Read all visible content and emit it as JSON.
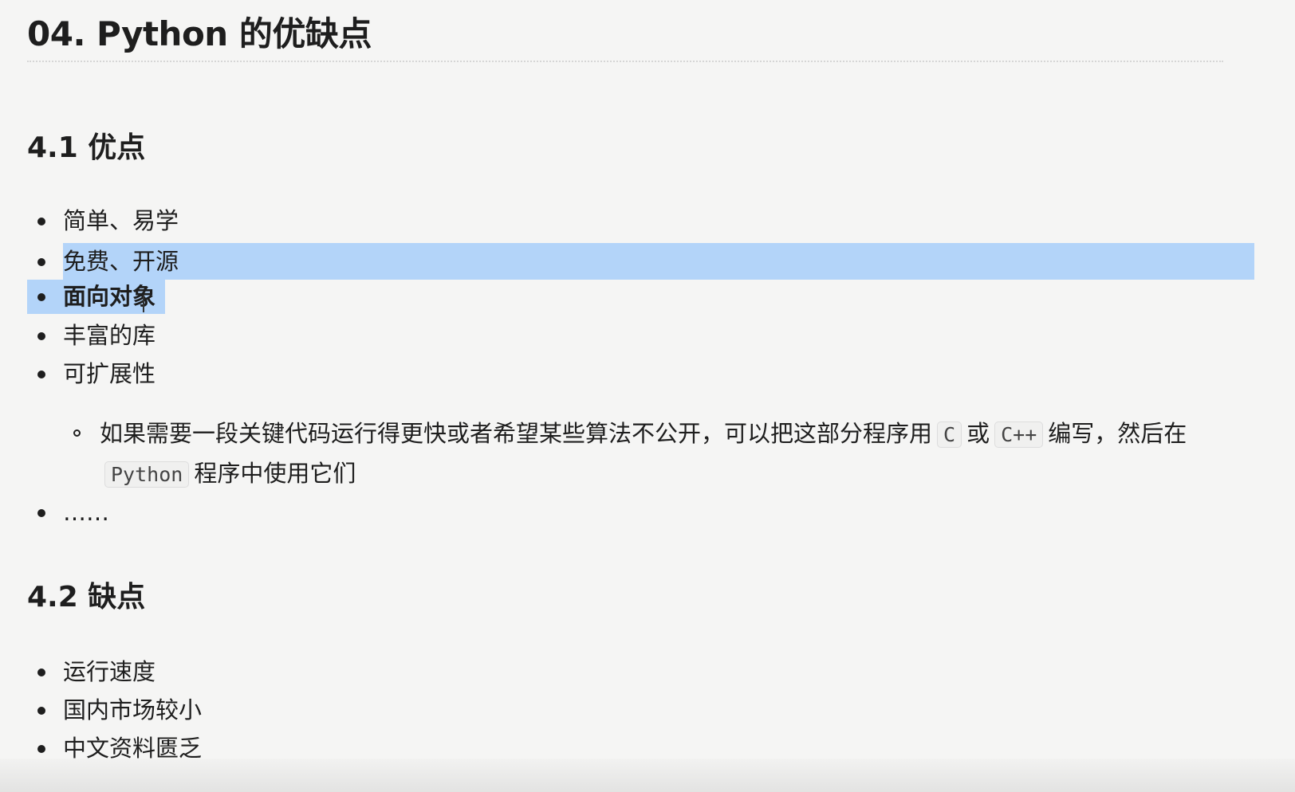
{
  "title": "04. Python 的优缺点",
  "sections": {
    "pros": {
      "heading": "4.1 优点",
      "items": [
        "简单、易学",
        "免费、开源",
        "面向对象",
        "丰富的库",
        "可扩展性"
      ],
      "sub_item": {
        "part1": "如果需要一段关键代码运行得更快或者希望某些算法不公开，可以把这部分程序用",
        "code1": "C",
        "part2": "或",
        "code2": "C++",
        "part3": "编写，然后在",
        "code3": "Python",
        "part4": "程序中使用它们"
      },
      "more": "……"
    },
    "cons": {
      "heading": "4.2 缺点",
      "items": [
        "运行速度",
        "国内市场较小",
        "中文资料匮乏"
      ]
    }
  },
  "colors": {
    "selection": "#b3d4f9",
    "text": "#1e1e1e",
    "background": "#f5f5f4"
  }
}
